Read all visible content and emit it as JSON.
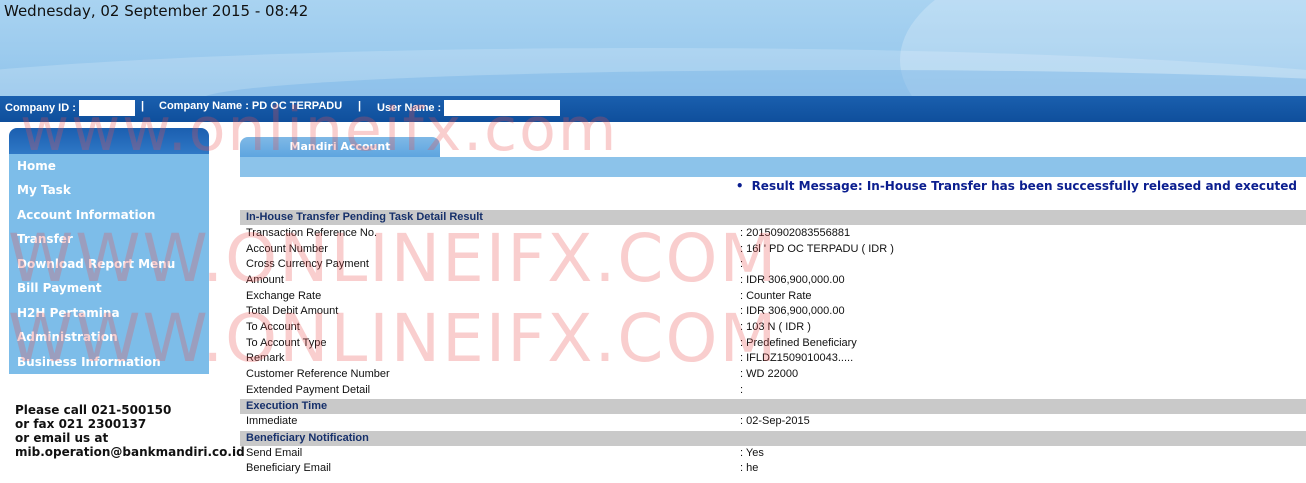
{
  "header": {
    "datetime": "Wednesday, 02 September 2015 - 08:42"
  },
  "info_bar": {
    "company_id_label": "Company ID :",
    "separator": "|",
    "company_name_label": "Company Name : PD OC TERPADU",
    "user_name_label": "User Name :"
  },
  "sidebar": {
    "items": [
      {
        "label": "Home"
      },
      {
        "label": "My Task"
      },
      {
        "label": "Account Information"
      },
      {
        "label": "Transfer"
      },
      {
        "label": "Download Report Menu"
      },
      {
        "label": "Bill Payment"
      },
      {
        "label": "H2H Pertamina"
      },
      {
        "label": "Administration"
      },
      {
        "label": "Business Information"
      }
    ],
    "contact": {
      "line1": "Please call 021-500150",
      "line2": "or fax 021 2300137",
      "line3": "or email us at",
      "line4": "mib.operation@bankmandiri.co.id"
    }
  },
  "tab": {
    "label": "Mandiri Account"
  },
  "result": {
    "bullet": "•",
    "message": "Result Message: In-House Transfer has been successfully released and executed"
  },
  "sections": {
    "detail_title": "In-House Transfer Pending Task Detail Result",
    "execution_title": "Execution Time",
    "notification_title": "Beneficiary Notification"
  },
  "details": [
    {
      "label": "Transaction Reference No.",
      "value": ": 20150902083556881"
    },
    {
      "label": "Account Number",
      "value": ": 16l                    ' PD OC TERPADU ( IDR )"
    },
    {
      "label": "Cross Currency Payment",
      "value": ":"
    },
    {
      "label": "Amount",
      "value": ": IDR   306,900,000.00"
    },
    {
      "label": "Exchange Rate",
      "value": ": Counter Rate"
    },
    {
      "label": "Total Debit Amount",
      "value": ": IDR 306,900,000.00"
    },
    {
      "label": "To Account",
      "value": ": 103                                        N ( IDR )"
    },
    {
      "label": "To Account Type",
      "value": ": Predefined Beneficiary"
    },
    {
      "label": "Remark",
      "value": ": IFLDZ1509010043....."
    },
    {
      "label": "Customer Reference Number",
      "value": ": WD 22000"
    },
    {
      "label": "Extended Payment Detail",
      "value": ":"
    }
  ],
  "execution": [
    {
      "label": "Immediate",
      "value": ": 02-Sep-2015"
    }
  ],
  "notification": [
    {
      "label": "Send Email",
      "value": ": Yes"
    },
    {
      "label": "Beneficiary Email",
      "value": ": he"
    }
  ],
  "watermarks": {
    "line1": "www.onlineifx.com",
    "line2": "WWW.ONLINEIFX.COM",
    "line3": "WWW.ONLINEIFX.COM"
  }
}
